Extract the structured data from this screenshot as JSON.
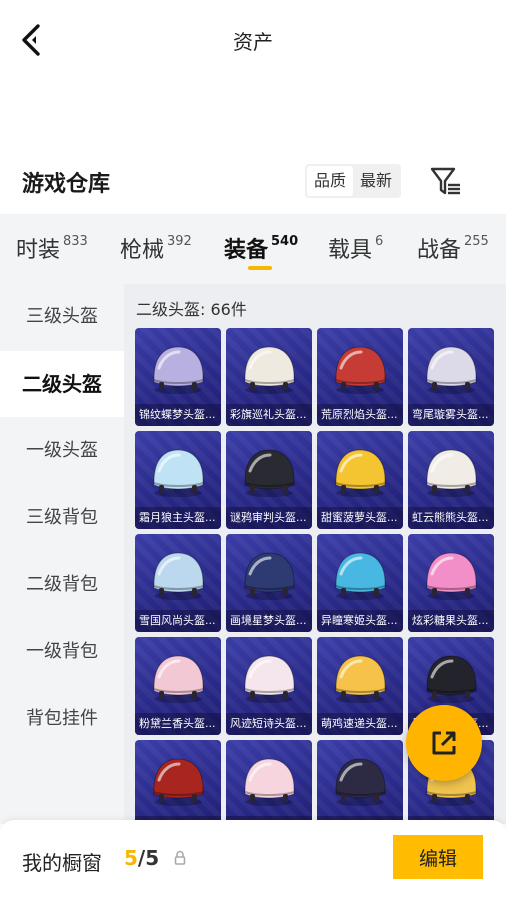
{
  "header": {
    "title": "资产"
  },
  "warehouse": {
    "title": "游戏仓库",
    "sort_options": [
      "品质",
      "最新"
    ],
    "active_sort": "品质"
  },
  "categories": [
    {
      "name": "时装",
      "count": "833"
    },
    {
      "name": "枪械",
      "count": "392"
    },
    {
      "name": "装备",
      "count": "540"
    },
    {
      "name": "载具",
      "count": "6"
    },
    {
      "name": "战备",
      "count": "255"
    }
  ],
  "active_category": "装备",
  "sidebar": {
    "items": [
      "三级头盔",
      "二级头盔",
      "一级头盔",
      "三级背包",
      "二级背包",
      "一级背包",
      "背包挂件"
    ],
    "active": "二级头盔"
  },
  "content": {
    "section_title": "二级头盔: 66件",
    "items": [
      {
        "name": "锦纹蝶梦头盔...",
        "icon": "helmet-butterfly-icon",
        "color": "#b7b0e0"
      },
      {
        "name": "彩旗巡礼头盔...",
        "icon": "helmet-flag-icon",
        "color": "#efe9df"
      },
      {
        "name": "荒原烈焰头盔...",
        "icon": "helmet-flame-icon",
        "color": "#c63b33"
      },
      {
        "name": "弯尾璇雾头盔...",
        "icon": "helmet-mist-icon",
        "color": "#dcd9e8"
      },
      {
        "name": "霜月狼主头盔...",
        "icon": "helmet-wolf-icon",
        "color": "#bfe3f5"
      },
      {
        "name": "谜鸦审判头盔...",
        "icon": "helmet-crow-icon",
        "color": "#2a2a33"
      },
      {
        "name": "甜蜜菠萝头盔...",
        "icon": "helmet-pineapple-icon",
        "color": "#f5c531"
      },
      {
        "name": "虹云熊熊头盔...",
        "icon": "helmet-bear-icon",
        "color": "#f1ede6"
      },
      {
        "name": "雪国风尚头盔...",
        "icon": "helmet-snow-icon",
        "color": "#bcd8ee"
      },
      {
        "name": "画境星梦头盔...",
        "icon": "helmet-starry-icon",
        "color": "#2e3a72"
      },
      {
        "name": "异瞳寒姬头盔...",
        "icon": "helmet-ice-icon",
        "color": "#48b7e2"
      },
      {
        "name": "炫彩糖果头盔...",
        "icon": "helmet-candy-icon",
        "color": "#f28fc8"
      },
      {
        "name": "粉黛兰香头盔...",
        "icon": "helmet-orchid-icon",
        "color": "#f2c8d4"
      },
      {
        "name": "风迹短诗头盔...",
        "icon": "helmet-poem-icon",
        "color": "#f4e6ec"
      },
      {
        "name": "萌鸡速递头盔...",
        "icon": "helmet-chick-icon",
        "color": "#f6c24a"
      },
      {
        "name": "墨影疾行头盔...",
        "icon": "helmet-orca-icon",
        "color": "#23232b"
      },
      {
        "name": "",
        "icon": "helmet-red-icon",
        "color": "#a8261f"
      },
      {
        "name": "",
        "icon": "helmet-bunny-icon",
        "color": "#f7d5df"
      },
      {
        "name": "",
        "icon": "helmet-dark-icon",
        "color": "#2d2a44"
      },
      {
        "name": "",
        "icon": "helmet-gold-icon",
        "color": "#f0c34e"
      }
    ]
  },
  "showcase": {
    "label": "我的橱窗",
    "current": "5",
    "separator": "/",
    "total": "5",
    "edit_label": "编辑"
  },
  "colors": {
    "accent": "#ffbc00",
    "card_bg": "#2a2a8a"
  }
}
